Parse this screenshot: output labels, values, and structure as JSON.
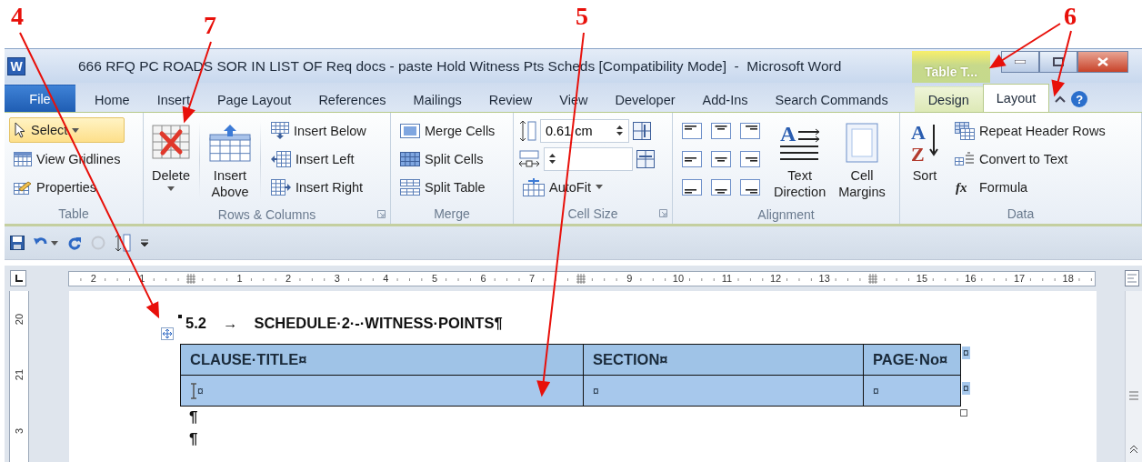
{
  "annotations": [
    {
      "label": "4"
    },
    {
      "label": "7"
    },
    {
      "label": "5"
    },
    {
      "label": "6"
    }
  ],
  "window": {
    "app_icon_text": "W",
    "title": "666 RFQ PC ROADS SOR IN LIST OF Req docs - paste Hold Witness Pts Scheds [Compatibility Mode]  -  Microsoft Word",
    "context_header": "Table T...",
    "help_label": "?"
  },
  "ribbon_tabs": [
    {
      "label": "File",
      "kind": "file",
      "selected": false
    },
    {
      "label": "Home",
      "kind": "tab",
      "selected": false
    },
    {
      "label": "Insert",
      "kind": "tab",
      "selected": false
    },
    {
      "label": "Page Layout",
      "kind": "tab",
      "selected": false
    },
    {
      "label": "References",
      "kind": "tab",
      "selected": false
    },
    {
      "label": "Mailings",
      "kind": "tab",
      "selected": false
    },
    {
      "label": "Review",
      "kind": "tab",
      "selected": false
    },
    {
      "label": "View",
      "kind": "tab",
      "selected": false
    },
    {
      "label": "Developer",
      "kind": "tab",
      "selected": false
    },
    {
      "label": "Add-Ins",
      "kind": "tab",
      "selected": false
    },
    {
      "label": "Search Commands",
      "kind": "tab",
      "selected": false
    },
    {
      "label": "Design",
      "kind": "context",
      "selected": false
    },
    {
      "label": "Layout",
      "kind": "context",
      "selected": true
    }
  ],
  "ribbon": {
    "groups": [
      {
        "label": "Table",
        "dialog_launcher": false,
        "items": [
          {
            "kind": "small",
            "label": "Select",
            "dropdown": true,
            "highlighted": true
          },
          {
            "kind": "small",
            "label": "View Gridlines",
            "dropdown": false,
            "highlighted": false
          },
          {
            "kind": "small",
            "label": "Properties",
            "dropdown": false,
            "highlighted": false
          }
        ]
      },
      {
        "label": "Rows & Columns",
        "dialog_launcher": true,
        "items": [
          {
            "kind": "large",
            "label": "Delete",
            "dropdown": true,
            "highlighted": false
          },
          {
            "kind": "large",
            "label": "Insert Above",
            "dropdown": false,
            "highlighted": false
          },
          {
            "kind": "small",
            "label": "Insert Below",
            "dropdown": false,
            "highlighted": false
          },
          {
            "kind": "small",
            "label": "Insert Left",
            "dropdown": false,
            "highlighted": false
          },
          {
            "kind": "small",
            "label": "Insert Right",
            "dropdown": false,
            "highlighted": false
          }
        ]
      },
      {
        "label": "Merge",
        "dialog_launcher": false,
        "items": [
          {
            "kind": "small",
            "label": "Merge Cells",
            "dropdown": false,
            "highlighted": false
          },
          {
            "kind": "small",
            "label": "Split Cells",
            "dropdown": false,
            "highlighted": false
          },
          {
            "kind": "small",
            "label": "Split Table",
            "dropdown": false,
            "highlighted": false
          }
        ]
      },
      {
        "label": "Cell Size",
        "dialog_launcher": true,
        "items": [
          {
            "kind": "size-field",
            "value": "0.61 cm"
          },
          {
            "kind": "size-field"
          },
          {
            "kind": "small",
            "label": "AutoFit",
            "dropdown": true,
            "highlighted": false
          }
        ]
      },
      {
        "label": "Alignment",
        "dialog_launcher": false,
        "items": [
          {
            "kind": "align"
          },
          {
            "kind": "align"
          },
          {
            "kind": "align"
          },
          {
            "kind": "align"
          },
          {
            "kind": "align"
          },
          {
            "kind": "align"
          },
          {
            "kind": "align"
          },
          {
            "kind": "align"
          },
          {
            "kind": "align"
          },
          {
            "kind": "large",
            "label": "Text Direction",
            "icon_text": "A",
            "dropdown": false,
            "highlighted": false
          },
          {
            "kind": "large",
            "label": "Cell Margins",
            "dropdown": false,
            "highlighted": false
          }
        ]
      },
      {
        "label": "Data",
        "dialog_launcher": false,
        "items": [
          {
            "kind": "large",
            "label": "Sort",
            "icon_text": "AZ",
            "dropdown": false,
            "highlighted": false
          },
          {
            "kind": "small",
            "label": "Repeat Header Rows",
            "dropdown": false,
            "highlighted": false
          },
          {
            "kind": "small",
            "label": "Convert to Text",
            "dropdown": false,
            "highlighted": false
          },
          {
            "kind": "small",
            "label": "Formula",
            "icon_text": "fx",
            "dropdown": false,
            "highlighted": false
          }
        ]
      }
    ]
  },
  "ruler": {
    "marks": [
      {
        "kind": "number",
        "label": "2"
      },
      {
        "kind": "number",
        "label": "1"
      },
      {
        "kind": "column-marker"
      },
      {
        "kind": "number",
        "label": "1"
      },
      {
        "kind": "number",
        "label": "2"
      },
      {
        "kind": "number",
        "label": "3"
      },
      {
        "kind": "number",
        "label": "4"
      },
      {
        "kind": "number",
        "label": "5"
      },
      {
        "kind": "number",
        "label": "6"
      },
      {
        "kind": "number",
        "label": "7"
      },
      {
        "kind": "column-marker"
      },
      {
        "kind": "number",
        "label": "9"
      },
      {
        "kind": "number",
        "label": "10"
      },
      {
        "kind": "number",
        "label": "11"
      },
      {
        "kind": "number",
        "label": "12"
      },
      {
        "kind": "number",
        "label": "13"
      },
      {
        "kind": "column-marker"
      },
      {
        "kind": "number",
        "label": "15"
      },
      {
        "kind": "number",
        "label": "16"
      },
      {
        "kind": "number",
        "label": "17"
      },
      {
        "kind": "number",
        "label": "18"
      }
    ]
  },
  "vertical_ruler": {
    "labels": [
      "20",
      "21",
      "3"
    ]
  },
  "document": {
    "heading": {
      "number": "5.2",
      "tab_mark": "→",
      "text": "SCHEDULE·2·-·WITNESS·POINTS¶"
    },
    "table": {
      "selected": true,
      "columns": [
        "CLAUSE·TITLE¤",
        "SECTION¤",
        "PAGE·No¤"
      ],
      "rows": [
        [
          "¤",
          "¤",
          "¤"
        ]
      ],
      "row_end_marks": [
        "¤",
        "¤"
      ]
    },
    "paragraph_marks": [
      "¶",
      "¶"
    ]
  }
}
